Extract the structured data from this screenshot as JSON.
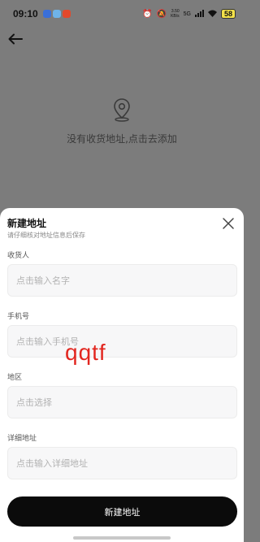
{
  "status_bar": {
    "time": "09:10",
    "speed_top": "3.50",
    "speed_bottom": "KB/s",
    "signal": "5G",
    "battery": "58"
  },
  "empty_state": {
    "icon": "location-pin-icon",
    "message": "没有收货地址,点击去添加"
  },
  "sheet": {
    "title": "新建地址",
    "subtitle": "请仔细核对地址信息后保存",
    "fields": {
      "receiver": {
        "label": "收货人",
        "placeholder": "点击输入名字"
      },
      "phone": {
        "label": "手机号",
        "placeholder": "点击输入手机号"
      },
      "region": {
        "label": "地区",
        "placeholder": "点击选择"
      },
      "detail": {
        "label": "详细地址",
        "placeholder": "点击输入详细地址"
      }
    },
    "submit_label": "新建地址"
  },
  "watermark": "qqtf",
  "colors": {
    "overlay": "#7c7c7c",
    "button": "#0b0b0b",
    "watermark": "#e2261f"
  }
}
